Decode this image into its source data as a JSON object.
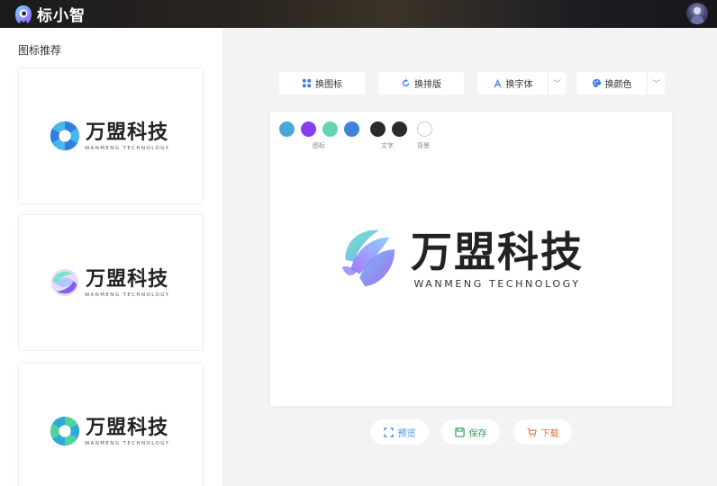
{
  "app": {
    "name": "标小智"
  },
  "sidebar": {
    "title": "图标推荐",
    "cards": [
      {
        "name": "万盟科技",
        "english": "WANMENG TECHNOLOGY"
      },
      {
        "name": "万盟科技",
        "english": "WANMENG TECHNOLOGY"
      },
      {
        "name": "万盟科技",
        "english": "WANMENG TECHNOLOGY"
      }
    ]
  },
  "toolbar": {
    "change_icon": "换图标",
    "change_layout": "换排版",
    "change_font": "换字体",
    "change_color": "换颜色"
  },
  "palette": {
    "icon_label": "图标",
    "text_label": "文字",
    "background_label": "背景",
    "icon_colors": [
      "#4aa8d8",
      "#8a3cf0",
      "#62d6b4",
      "#3f82d8"
    ],
    "text_colors": [
      "#2b2b2b",
      "#2b2b2b"
    ],
    "background_color": "#ffffff"
  },
  "logo": {
    "name": "万盟科技",
    "english": "WANMENG TECHNOLOGY"
  },
  "actions": {
    "preview": "预览",
    "save": "保存",
    "download": "下载"
  },
  "colors": {
    "preview": "#3a8ee6",
    "save": "#2e9e55",
    "download": "#e8703a"
  }
}
